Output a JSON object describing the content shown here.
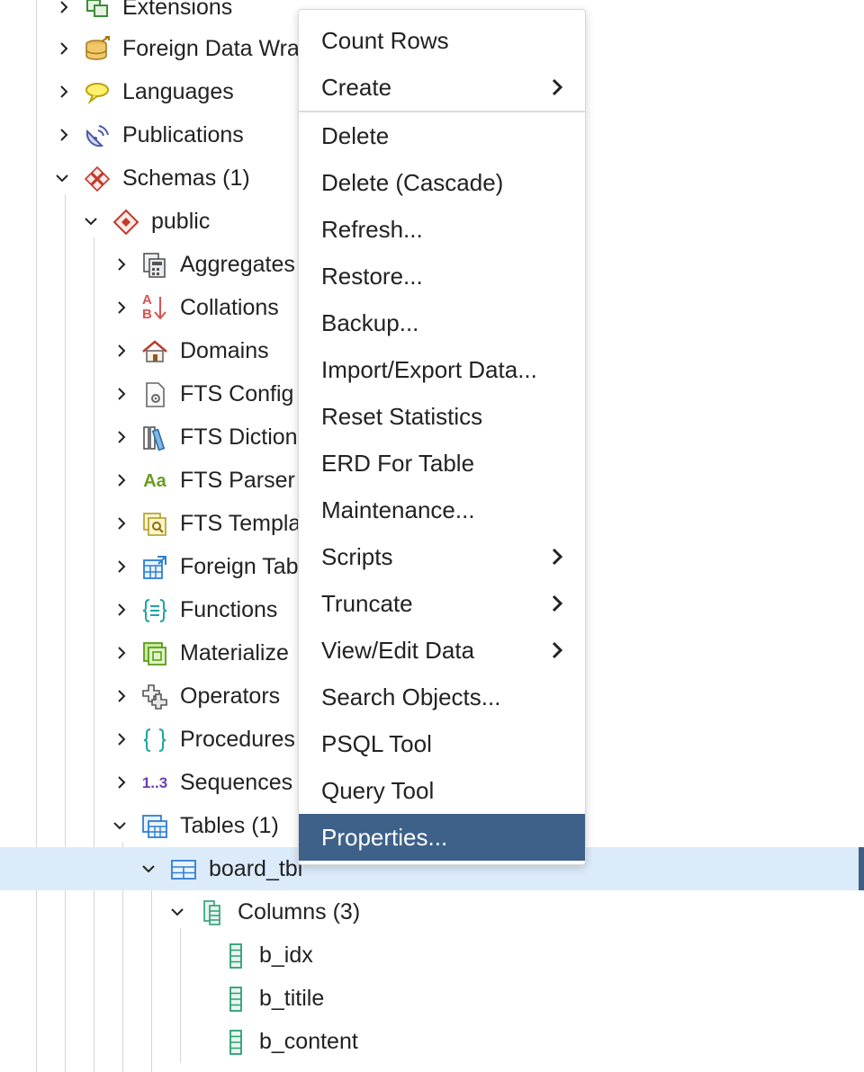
{
  "tree": {
    "nodes": [
      {
        "label": "Extensions",
        "icon": "extensions-icon",
        "expanded": false
      },
      {
        "label": "Foreign Data Wra",
        "icon": "foreign-data-wrapper-icon",
        "expanded": false
      },
      {
        "label": "Languages",
        "icon": "languages-icon",
        "expanded": false
      },
      {
        "label": "Publications",
        "icon": "publications-icon",
        "expanded": false
      },
      {
        "label": "Schemas (1)",
        "icon": "schemas-icon",
        "expanded": true
      },
      {
        "label": "public",
        "icon": "schema-icon",
        "expanded": true
      },
      {
        "label": "Aggregates",
        "icon": "aggregates-icon",
        "expanded": false
      },
      {
        "label": "Collations",
        "icon": "collations-icon",
        "expanded": false
      },
      {
        "label": "Domains",
        "icon": "domains-icon",
        "expanded": false
      },
      {
        "label": "FTS Config",
        "icon": "fts-configuration-icon",
        "expanded": false
      },
      {
        "label": "FTS Diction",
        "icon": "fts-dictionary-icon",
        "expanded": false
      },
      {
        "label": "FTS Parser",
        "icon": "fts-parser-icon",
        "expanded": false
      },
      {
        "label": "FTS Templa",
        "icon": "fts-template-icon",
        "expanded": false
      },
      {
        "label": "Foreign Tab",
        "icon": "foreign-table-icon",
        "expanded": false
      },
      {
        "label": "Functions",
        "icon": "functions-icon",
        "expanded": false
      },
      {
        "label": "Materialize",
        "icon": "materialized-view-icon",
        "expanded": false
      },
      {
        "label": "Operators",
        "icon": "operators-icon",
        "expanded": false
      },
      {
        "label": "Procedures",
        "icon": "procedures-icon",
        "expanded": false
      },
      {
        "label": "Sequences",
        "icon": "sequences-icon",
        "expanded": false
      },
      {
        "label": "Tables (1)",
        "icon": "tables-icon",
        "expanded": true
      },
      {
        "label": "board_tbl",
        "icon": "table-icon",
        "expanded": true,
        "selected": true
      },
      {
        "label": "Columns (3)",
        "icon": "columns-icon",
        "expanded": true
      },
      {
        "label": "b_idx",
        "icon": "column-icon"
      },
      {
        "label": "b_titile",
        "icon": "column-icon"
      },
      {
        "label": "b_content",
        "icon": "column-icon"
      }
    ],
    "icon_text": {
      "fts_parser": "Aa",
      "sequences": "1..3",
      "collations_top": "A",
      "collations_bottom": "B"
    }
  },
  "context_menu": {
    "items": [
      {
        "label": "Count Rows",
        "submenu": false
      },
      {
        "label": "Create",
        "submenu": true
      },
      {
        "label": "Delete",
        "submenu": false
      },
      {
        "label": "Delete (Cascade)",
        "submenu": false
      },
      {
        "label": "Refresh...",
        "submenu": false
      },
      {
        "label": "Restore...",
        "submenu": false
      },
      {
        "label": "Backup...",
        "submenu": false
      },
      {
        "label": "Import/Export Data...",
        "submenu": false
      },
      {
        "label": "Reset Statistics",
        "submenu": false
      },
      {
        "label": "ERD For Table",
        "submenu": false
      },
      {
        "label": "Maintenance...",
        "submenu": false
      },
      {
        "label": "Scripts",
        "submenu": true
      },
      {
        "label": "Truncate",
        "submenu": true
      },
      {
        "label": "View/Edit Data",
        "submenu": true
      },
      {
        "label": "Search Objects...",
        "submenu": false
      },
      {
        "label": "PSQL Tool",
        "submenu": false
      },
      {
        "label": "Query Tool",
        "submenu": false
      },
      {
        "label": "Properties...",
        "submenu": false,
        "active": true
      }
    ]
  },
  "colors": {
    "selection_row": "#dcebfa",
    "menu_active": "#3e6189",
    "selection_edge": "#3f5f86"
  }
}
